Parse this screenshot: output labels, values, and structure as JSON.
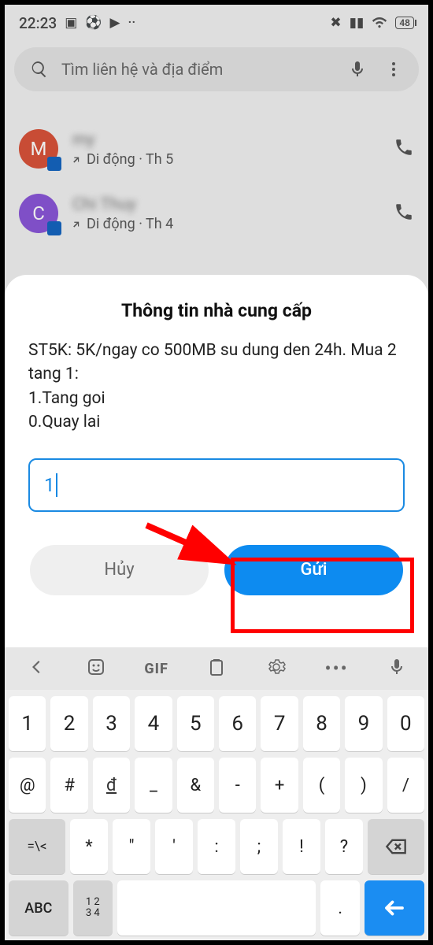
{
  "status": {
    "time": "22:23"
  },
  "search": {
    "placeholder": "Tìm liên hệ và địa điểm"
  },
  "contacts": [
    {
      "initial": "M",
      "avatar_class": "m",
      "name": "my",
      "line": "Di động · Th 5"
    },
    {
      "initial": "C",
      "avatar_class": "c",
      "name": "Chi Thuy",
      "line": "Di động · Th 4"
    }
  ],
  "dialog": {
    "title": "Thông tin nhà cung cấp",
    "body": "ST5K: 5K/ngay co 500MB su dung den 24h. Mua 2 tang 1:\n1.Tang goi\n0.Quay lai",
    "input_value": "1",
    "cancel": "Hủy",
    "send": "Gửi"
  },
  "keyboard": {
    "top": {
      "gif": "GIF"
    },
    "row1": [
      "1",
      "2",
      "3",
      "4",
      "5",
      "6",
      "7",
      "8",
      "9",
      "0"
    ],
    "row2": [
      "@",
      "#",
      "đ",
      "_",
      "&",
      "-",
      "+",
      "(",
      ")",
      "/"
    ],
    "row3_lead": "=\\<",
    "row3": [
      "*",
      "\"",
      "'",
      ":",
      ";",
      "!",
      "?"
    ],
    "abc": "ABC",
    "numgrid": "1 2\n3 4"
  }
}
